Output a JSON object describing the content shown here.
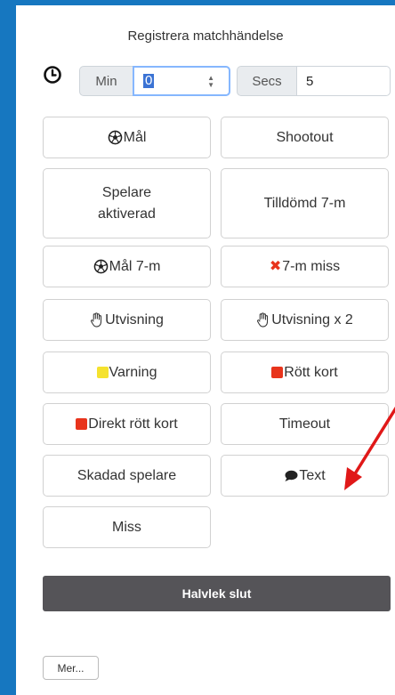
{
  "header": {
    "title": "Registrera matchhändelse"
  },
  "time": {
    "icon": "clock-icon",
    "min_label": "Min",
    "min_value": "0",
    "secs_label": "Secs",
    "secs_value": "5"
  },
  "events": [
    {
      "id": "goal",
      "label": "Mål",
      "icon": "soccer-ball-icon"
    },
    {
      "id": "shootout",
      "label": "Shootout",
      "icon": ""
    },
    {
      "id": "player-activated",
      "label": "Spelare aktiverad",
      "icon": ""
    },
    {
      "id": "awarded-7m",
      "label": "Tilldömd 7-m",
      "icon": ""
    },
    {
      "id": "goal-7m",
      "label": "Mål 7-m",
      "icon": "soccer-ball-icon"
    },
    {
      "id": "miss-7m",
      "label": "7-m miss",
      "icon": "red-x-icon"
    },
    {
      "id": "suspension",
      "label": "Utvisning",
      "icon": "hand-icon"
    },
    {
      "id": "suspension-x2",
      "label": "Utvisning x 2",
      "icon": "hand-icon"
    },
    {
      "id": "warning",
      "label": "Varning",
      "icon": "yellow-card-icon"
    },
    {
      "id": "red-card",
      "label": "Rött kort",
      "icon": "red-card-icon"
    },
    {
      "id": "direct-red-card",
      "label": "Direkt rött kort",
      "icon": "red-card-icon"
    },
    {
      "id": "timeout",
      "label": "Timeout",
      "icon": ""
    },
    {
      "id": "injured-player",
      "label": "Skadad spelare",
      "icon": ""
    },
    {
      "id": "text",
      "label": "Text",
      "icon": "speech-bubble-icon"
    },
    {
      "id": "miss",
      "label": "Miss",
      "icon": ""
    }
  ],
  "actions": {
    "halftime_end": "Halvlek slut",
    "more": "Mer..."
  },
  "colors": {
    "background": "#1677c0",
    "dark_button": "#555458",
    "yellow": "#f5e22e",
    "red": "#e8341c"
  }
}
